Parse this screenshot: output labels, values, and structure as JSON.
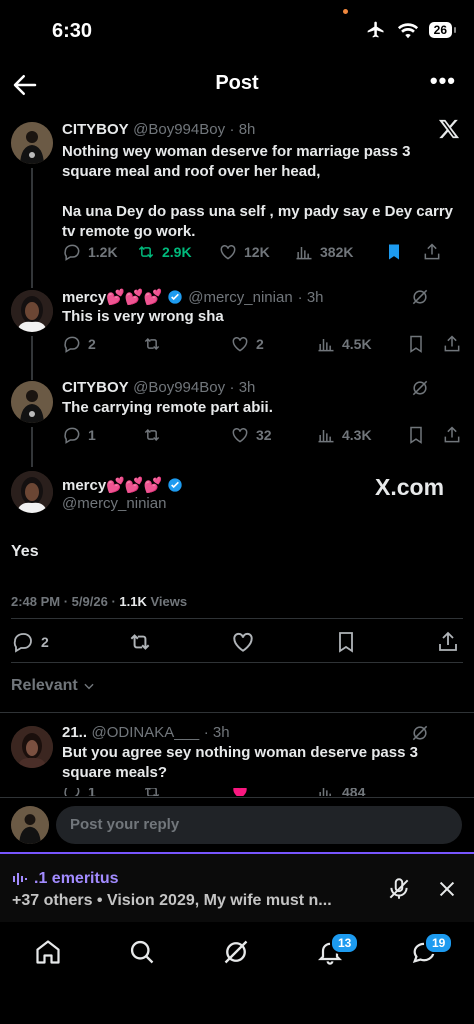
{
  "status_bar": {
    "time": "6:30",
    "battery": "26"
  },
  "header": {
    "title": "Post"
  },
  "main_post": {
    "author": "CITYBOY",
    "handle": "@Boy994Boy",
    "age": "· 8h",
    "text": "Nothing wey woman deserve for marriage pass 3 square meal and roof over her head,\n\nNa una Dey do pass una self ,  my pady say e Dey carry tv remote go work.",
    "replies": "1.2K",
    "reposts": "2.9K",
    "likes": "12K",
    "views": "382K"
  },
  "reply_1": {
    "author": "mercy💕💕💕",
    "handle": "@mercy_ninian",
    "age": "· 3h",
    "text": "This is very wrong sha",
    "replies": "2",
    "likes": "2",
    "views": "4.5K"
  },
  "reply_2": {
    "author": "CITYBOY",
    "handle": "@Boy994Boy",
    "age": "· 3h",
    "text": "The carrying remote part abii.",
    "replies": "1",
    "likes": "32",
    "views": "4.3K"
  },
  "focus_post": {
    "author": "mercy💕💕💕",
    "handle": "@mercy_ninian",
    "watermark": "X.com",
    "text": "Yes",
    "timestamp": "2:48 PM · 5/9/26 · ",
    "views_count": "1.1K",
    "views_label": " Views",
    "replies": "2"
  },
  "relevant": {
    "label": "Relevant"
  },
  "reply_3": {
    "author": "21..",
    "handle": "@ODINAKA___",
    "age": "· 3h",
    "text": "But you agree sey nothing woman deserve pass 3 square meals?",
    "replies": "1",
    "views": "484"
  },
  "composer": {
    "placeholder": "Post your reply"
  },
  "space": {
    "title": ".1 emeritus",
    "subtitle": "+37 others • Vision 2029, My wife must n..."
  },
  "tabbar": {
    "notifications_badge": "13",
    "messages_badge": "19"
  },
  "colors": {
    "accent": "#1d9bf0",
    "repost_green": "#00ba7c",
    "like_pink": "#f91880",
    "space_purple": "#7856ff"
  }
}
